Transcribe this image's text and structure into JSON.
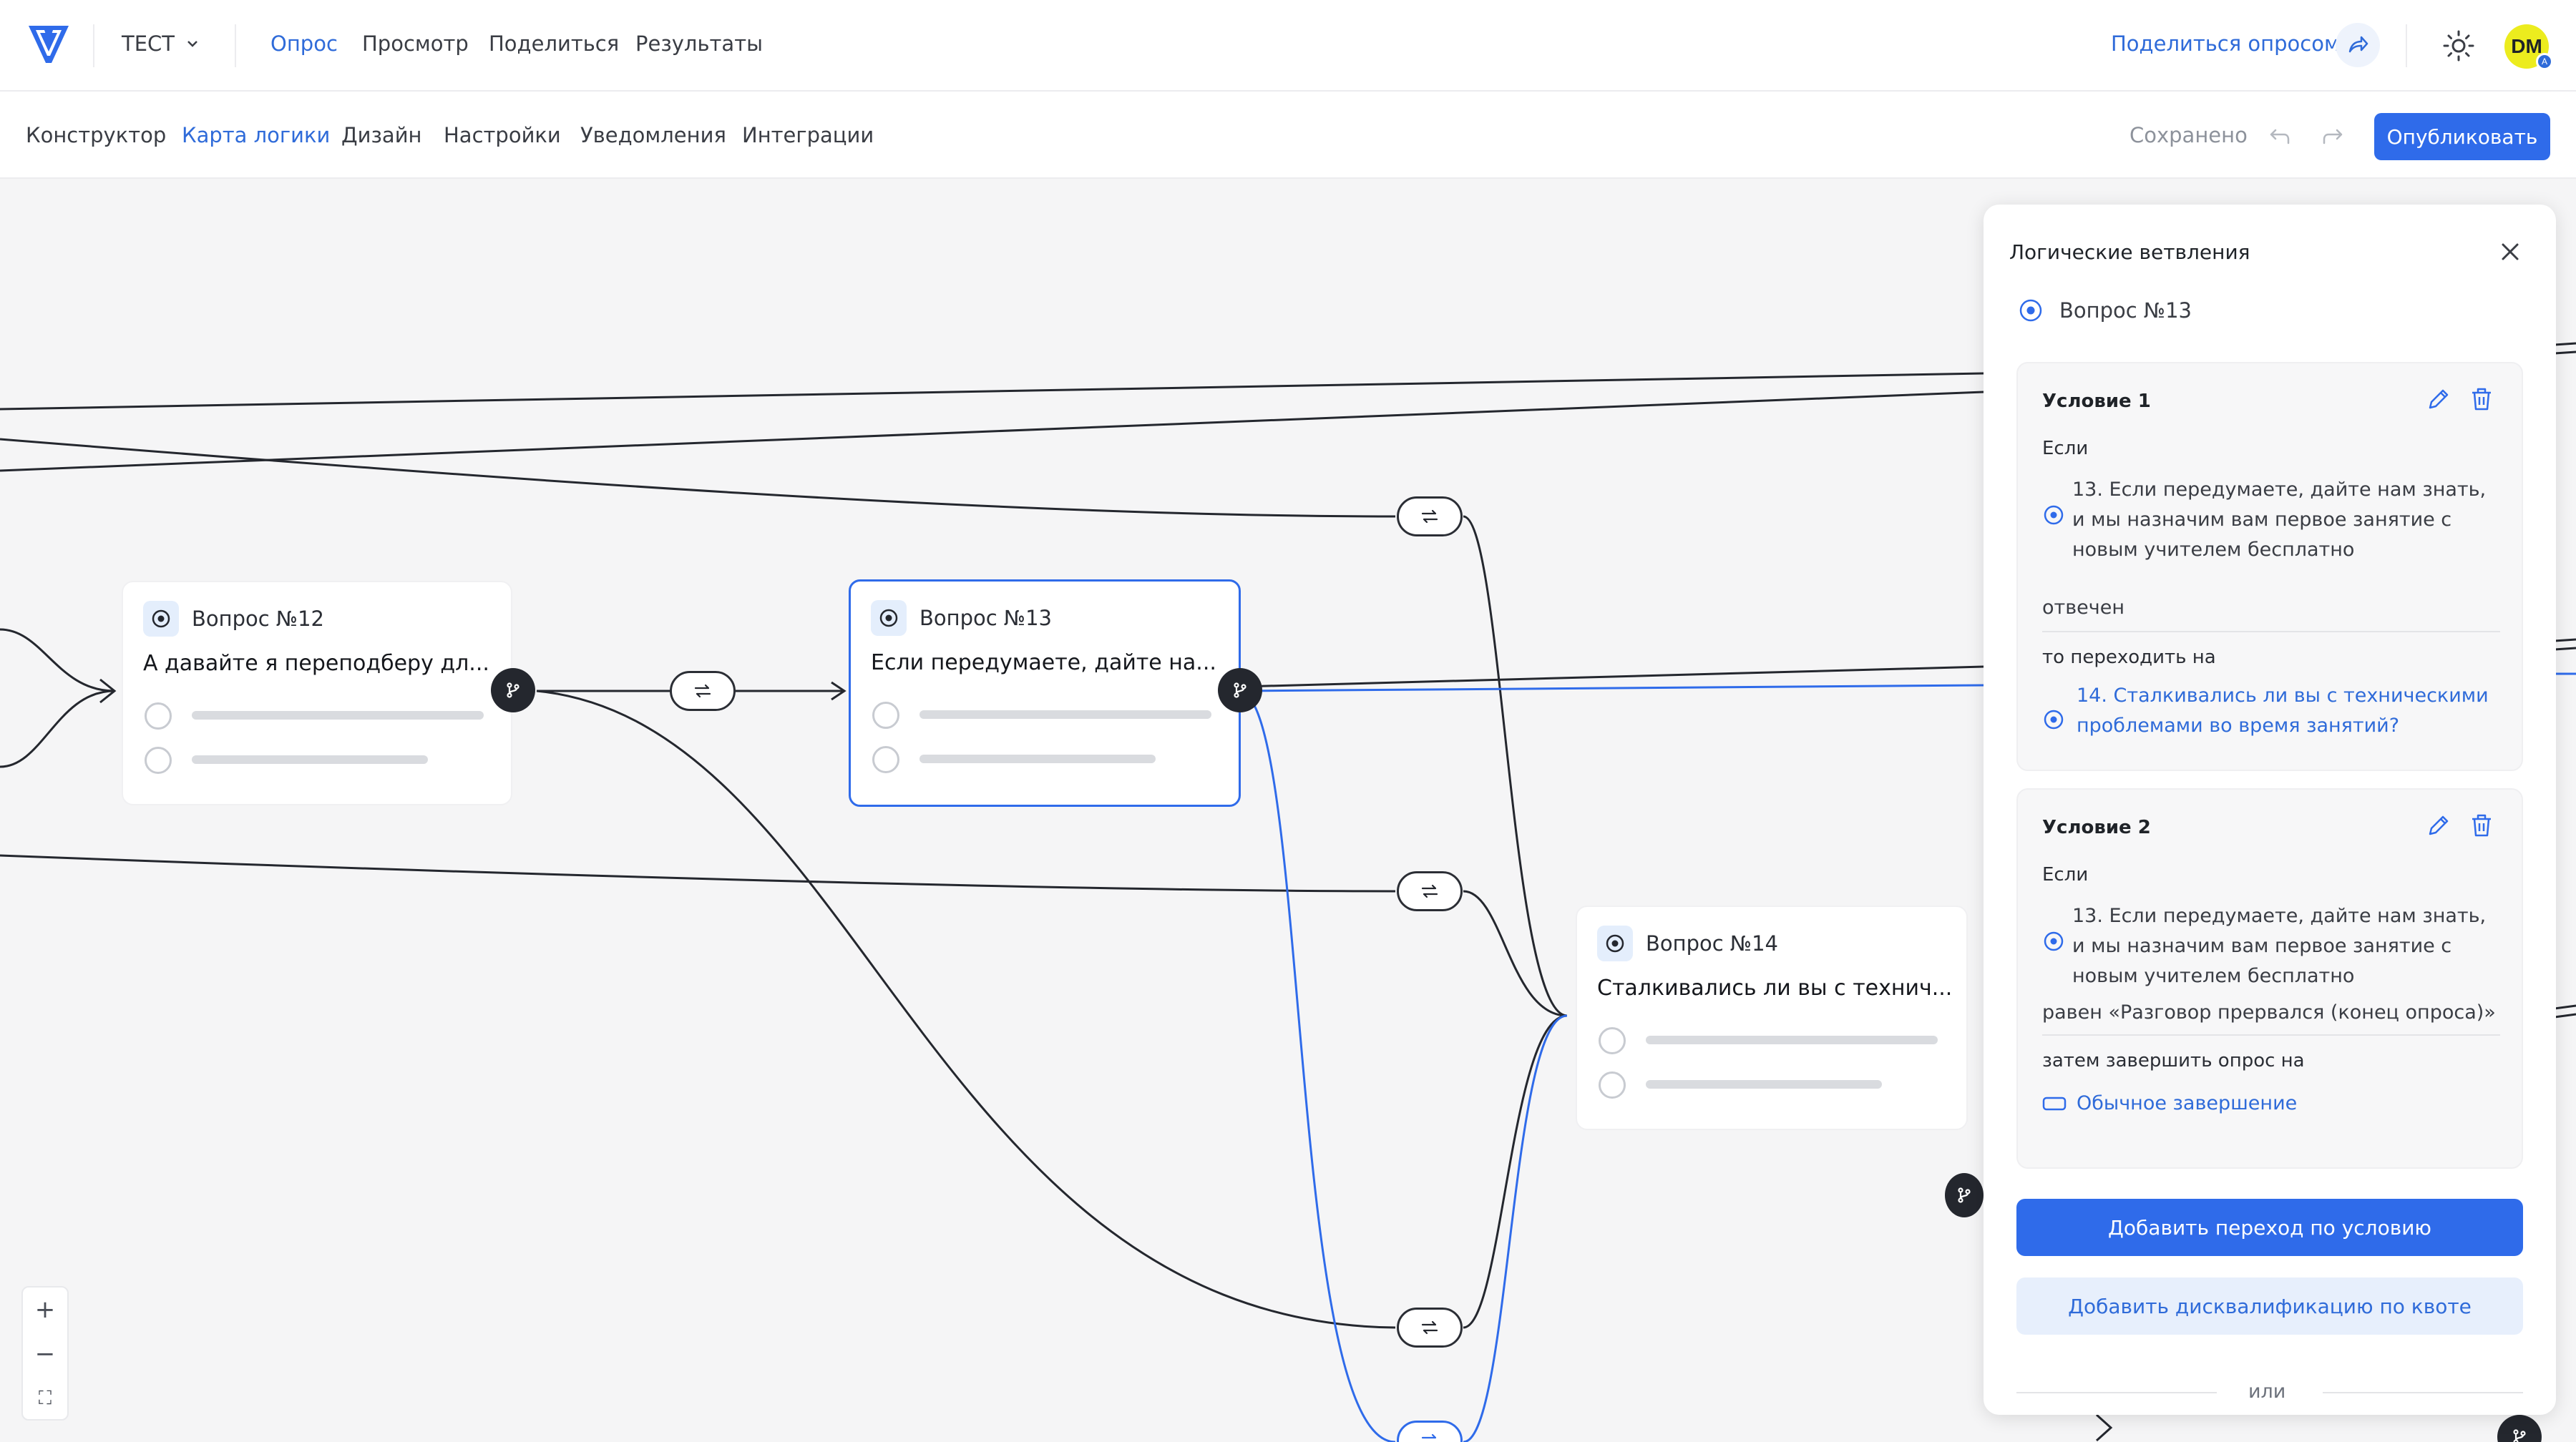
{
  "topbar": {
    "survey_name": "ТЕСТ",
    "nav": [
      "Опрос",
      "Просмотр",
      "Поделиться",
      "Результаты"
    ],
    "active_nav": "Опрос",
    "share_link": "Поделиться опросом",
    "avatar_initials": "DM",
    "avatar_badge": "A"
  },
  "subbar": {
    "tabs": [
      "Конструктор",
      "Карта логики",
      "Дизайн",
      "Настройки",
      "Уведомления",
      "Интеграции"
    ],
    "active_tab": "Карта логики",
    "saved_status": "Сохранено",
    "publish_label": "Опубликовать"
  },
  "canvas": {
    "cards": [
      {
        "label": "Вопрос №12",
        "title": "А давайте я переподберу дл..."
      },
      {
        "label": "Вопрос №13",
        "title": "Если передумаете, дайте на..."
      },
      {
        "label": "Вопрос №14",
        "title": "Сталкивались ли вы с технич..."
      }
    ],
    "zoom": {
      "in": "+",
      "out": "−",
      "fit": "⛶"
    }
  },
  "panel": {
    "title": "Логические ветвления",
    "question": "Вопрос №13",
    "conditions": [
      {
        "title": "Условие 1",
        "if_label": "Если",
        "question_text": "13. Если передумаете, дайте нам знать, и мы назначим вам первое занятие с новым учителем бесплатно",
        "operator": "отвечен",
        "then_label": "то переходить на",
        "target": "14. Сталкивались ли вы с техническими проблемами во время занятий?"
      },
      {
        "title": "Условие 2",
        "if_label": "Если",
        "question_text": "13. Если передумаете, дайте нам знать, и мы назначим вам первое занятие с новым учителем бесплатно",
        "operator": "равен  «Разговор прервался (конец опроса)»",
        "then_label": "затем завершить опрос на",
        "target": "Обычное завершение"
      }
    ],
    "add_condition": "Добавить переход по условию",
    "add_quota": "Добавить дисквалификацию по квоте",
    "or_label": "или"
  },
  "colors": {
    "accent": "#2f6bea",
    "link": "#2f6bd9",
    "edge": "#24272e",
    "avatar": "#ecec1e"
  }
}
